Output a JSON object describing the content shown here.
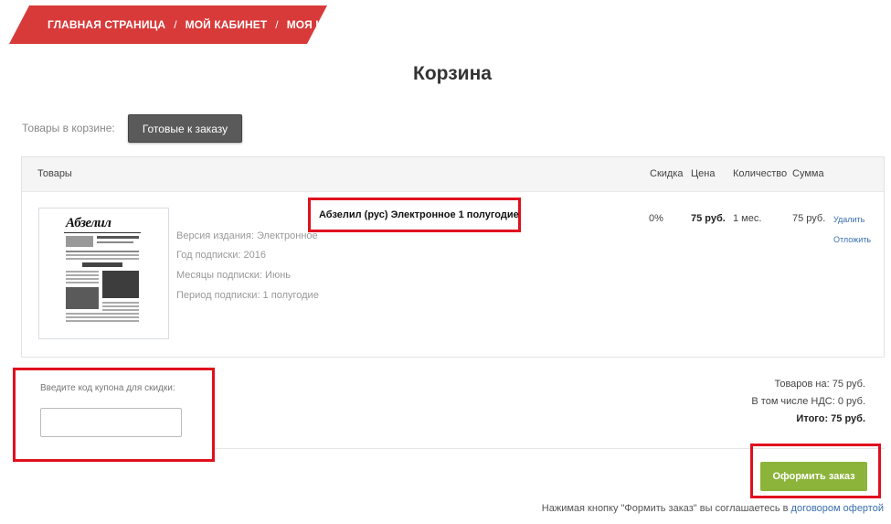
{
  "breadcrumb": {
    "items": [
      "ГЛАВНАЯ СТРАНИЦА",
      "МОЙ КАБИНЕТ",
      "МОЯ КОРЗИНА"
    ],
    "separator": "/"
  },
  "page": {
    "title": "Корзина"
  },
  "cart_filter": {
    "label": "Товары в корзине:",
    "ready_button": "Готовые к заказу"
  },
  "table": {
    "headers": {
      "goods": "Товары",
      "discount": "Скидка",
      "price": "Цена",
      "quantity": "Количество",
      "sum": "Сумма"
    },
    "item": {
      "thumbnail_title": "Абзелил",
      "name": "Абзелил (рус) Электронное 1 полугодие",
      "edition": "Версия издания: Электронное",
      "year": "Год подписки: 2016",
      "months": "Месяцы подписки: Июнь",
      "period": "Период подписки: 1 полугодие",
      "discount": "0%",
      "price": "75 руб.",
      "quantity": "1 мес.",
      "sum": "75 руб.",
      "delete_label": "Удалить",
      "postpone_label": "Отложить"
    }
  },
  "coupon": {
    "label": "Введите код купона для скидки:",
    "value": ""
  },
  "totals": {
    "goods": "Товаров на:  75 руб.",
    "vat": "В том числе НДС:    0 руб.",
    "total": "Итого: 75 руб."
  },
  "order": {
    "button": "Оформить заказ"
  },
  "agreement": {
    "text": "Нажимая кнопку \"Формить заказ\" вы соглашаетесь в ",
    "link": "договором офертой"
  },
  "colors": {
    "breadcrumb_bg": "#d83a3a",
    "highlight_border": "#e0101e",
    "order_button": "#8cb33a",
    "ready_button": "#5a5a5a",
    "link": "#3a6fb0"
  }
}
